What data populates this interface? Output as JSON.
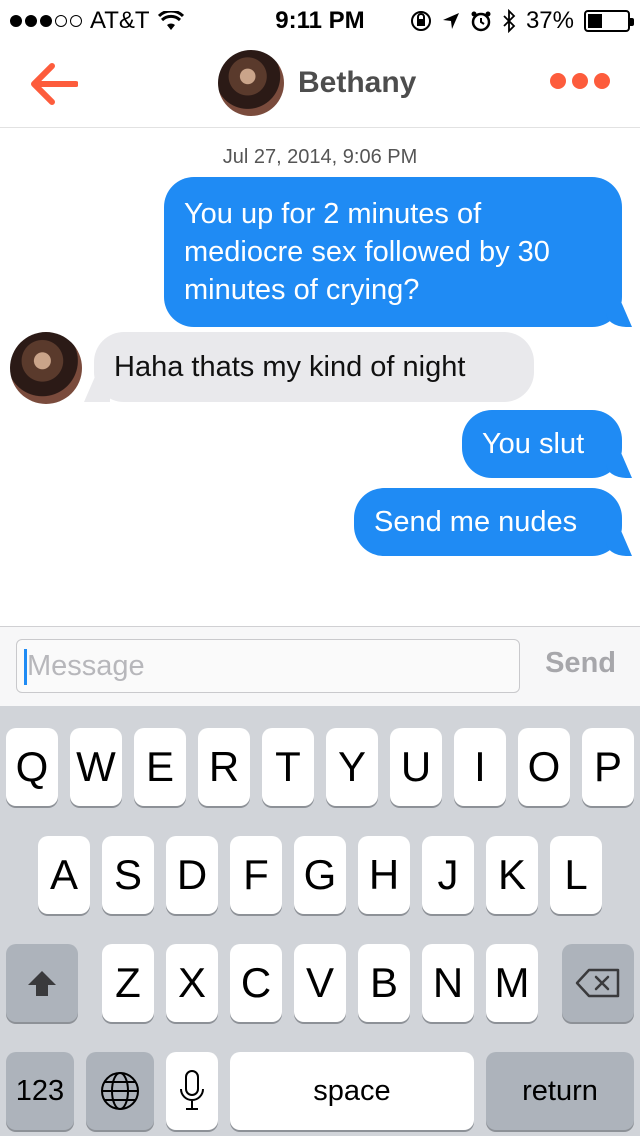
{
  "status_bar": {
    "carrier": "AT&T",
    "time": "9:11 PM",
    "battery_percent": "37%",
    "battery_level": 0.37,
    "icons": [
      "signal-dots-icon",
      "wifi-icon",
      "rotation-lock-icon",
      "location-icon",
      "alarm-icon",
      "bluetooth-icon",
      "battery-icon"
    ]
  },
  "nav": {
    "contact_name": "Bethany",
    "accent_color": "#fd5c3c"
  },
  "conversation": {
    "timestamp": "Jul 27, 2014, 9:06 PM",
    "messages": [
      {
        "direction": "outgoing",
        "text": "You up for 2 minutes of mediocre sex followed by 30 minutes of crying?"
      },
      {
        "direction": "incoming",
        "text": "Haha thats my kind of night"
      },
      {
        "direction": "outgoing",
        "text": "You slut"
      },
      {
        "direction": "outgoing",
        "text": "Send me nudes"
      }
    ],
    "outgoing_color": "#1f8bf4",
    "incoming_color": "#e9e9ec"
  },
  "input_bar": {
    "placeholder": "Message",
    "value": "",
    "send_label": "Send"
  },
  "keyboard": {
    "row1": [
      "Q",
      "W",
      "E",
      "R",
      "T",
      "Y",
      "U",
      "I",
      "O",
      "P"
    ],
    "row2": [
      "A",
      "S",
      "D",
      "F",
      "G",
      "H",
      "J",
      "K",
      "L"
    ],
    "row3": [
      "Z",
      "X",
      "C",
      "V",
      "B",
      "N",
      "M"
    ],
    "numbers_label": "123",
    "space_label": "space",
    "return_label": "return"
  }
}
